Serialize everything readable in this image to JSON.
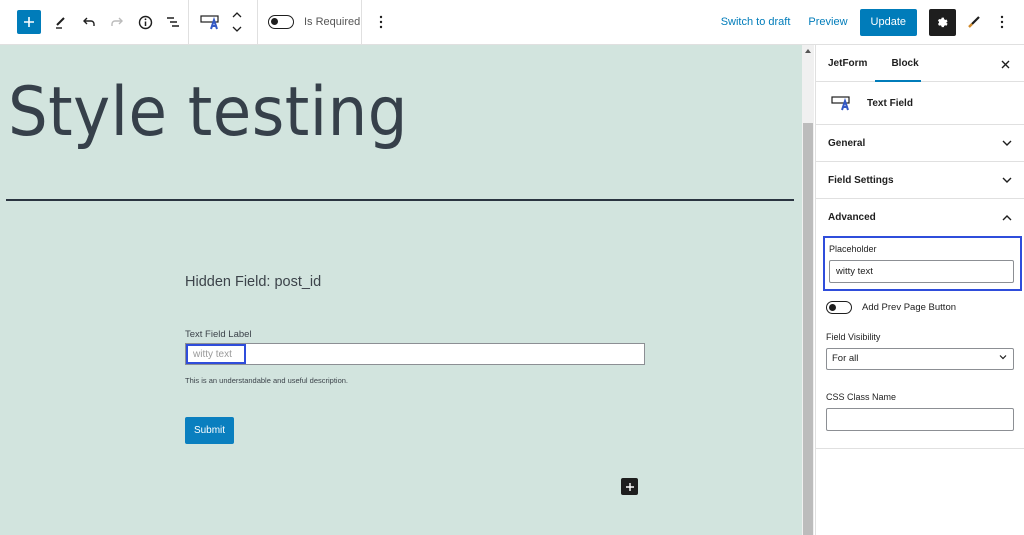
{
  "toolbar": {
    "is_required_label": "Is Required",
    "switch_to_draft": "Switch to draft",
    "preview": "Preview",
    "update": "Update"
  },
  "icons": {
    "add": "plus-icon",
    "edit": "pencil-icon",
    "undo": "undo-icon",
    "redo": "redo-icon",
    "info": "info-icon",
    "list_view": "list-view-icon",
    "block_type": "text-field-icon",
    "move": "chevron-up-down-icon",
    "more": "more-vertical-icon",
    "settings": "gear-icon",
    "styles": "brush-icon",
    "close": "close-icon"
  },
  "canvas": {
    "post_title": "Style testing",
    "hidden_field": "Hidden Field: post_id",
    "text_field_label": "Text Field Label",
    "text_field_placeholder": "witty text",
    "description": "This is an understandable and useful description.",
    "submit_label": "Submit"
  },
  "sidebar": {
    "tabs": [
      {
        "label": "JetForm",
        "active": false
      },
      {
        "label": "Block",
        "active": true
      }
    ],
    "block_name": "Text Field",
    "panels": [
      {
        "title": "General",
        "expanded": false
      },
      {
        "title": "Field Settings",
        "expanded": false
      },
      {
        "title": "Advanced",
        "expanded": true
      }
    ],
    "advanced": {
      "placeholder_label": "Placeholder",
      "placeholder_value": "witty text",
      "prev_page_label": "Add Prev Page Button",
      "prev_page_enabled": false,
      "visibility_label": "Field Visibility",
      "visibility_value": "For all",
      "css_class_label": "CSS Class Name",
      "css_class_value": ""
    }
  },
  "colors": {
    "accent": "#007cba",
    "canvas_bg": "#d2e4de",
    "highlight": "#2f4ddb",
    "dark": "#1e1e1e"
  }
}
